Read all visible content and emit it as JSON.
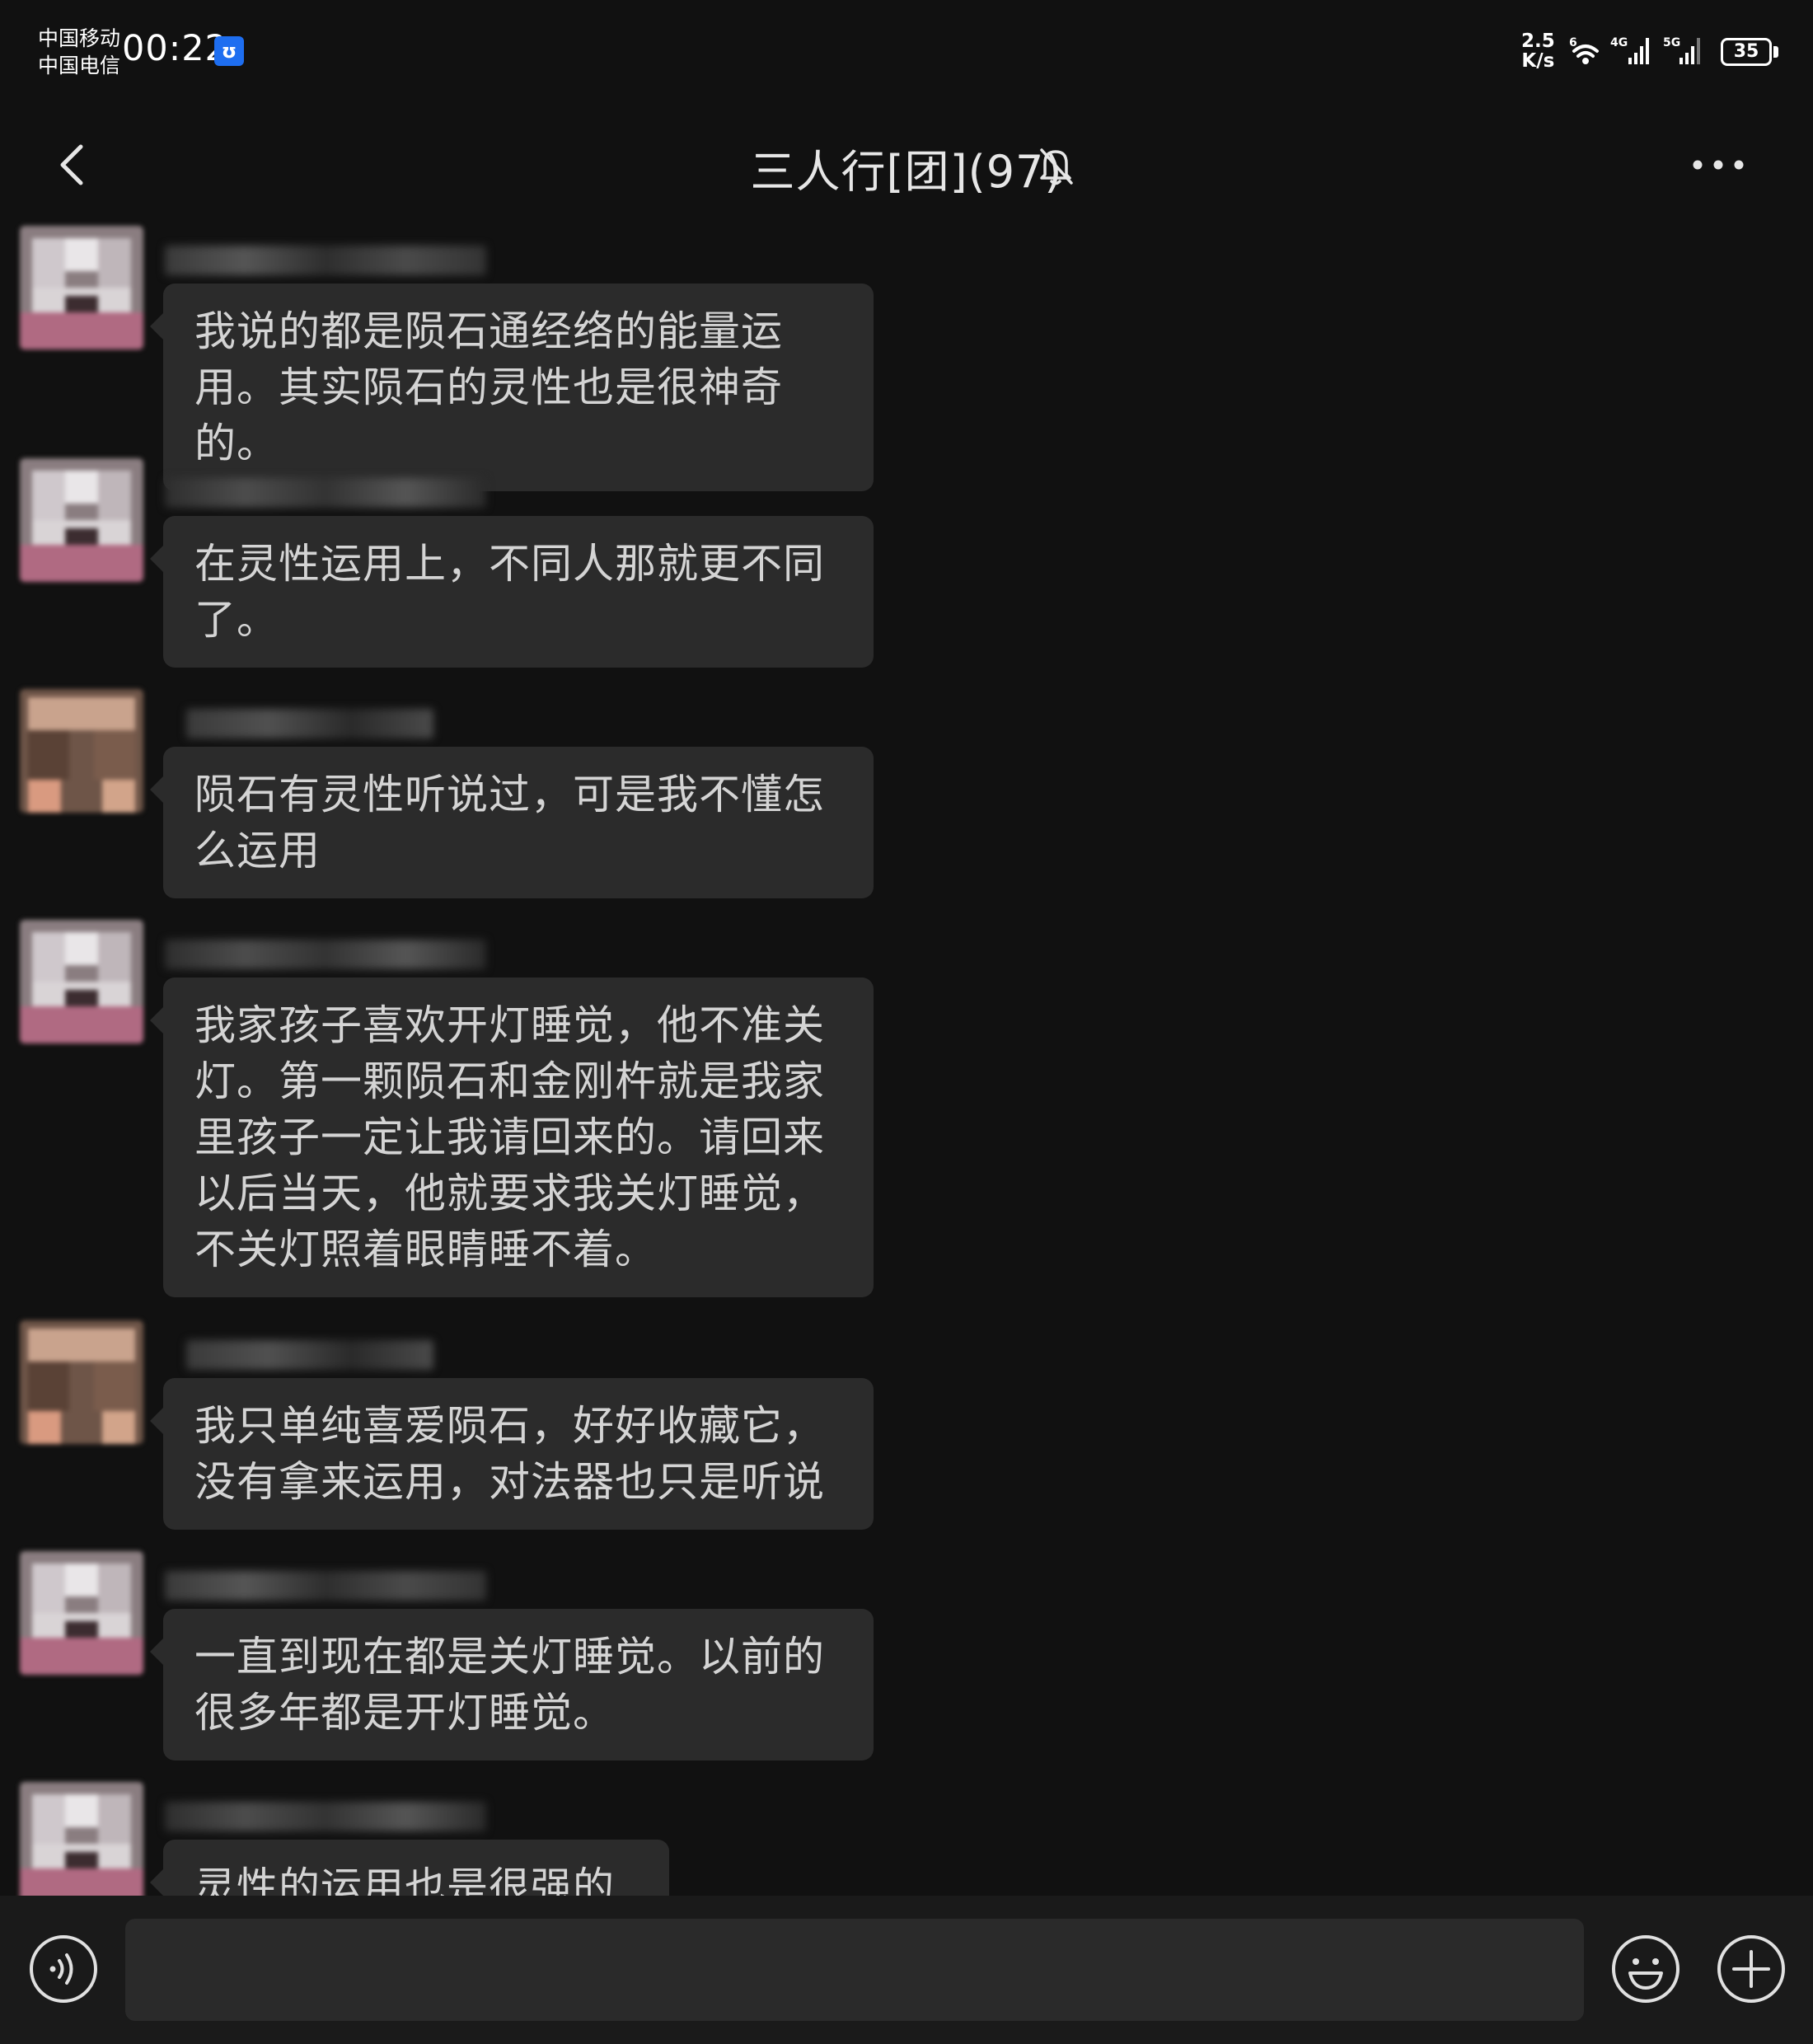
{
  "status_bar": {
    "carrier_1": "中国移动",
    "carrier_2": "中国电信",
    "time": "00:22",
    "app_badge": "ʊ",
    "speed_value": "2.5",
    "speed_unit": "K/s",
    "wifi_label": "6",
    "sim1_label": "4G",
    "sim2_label": "5G",
    "battery": "35"
  },
  "header": {
    "title": "三人行[团](97)",
    "back_icon": "chevron-left-icon",
    "mute_icon": "bell-off-icon",
    "more_icon": "more-dots-icon"
  },
  "messages": [
    {
      "text": "我说的都是陨石通经络的能量运用。其实陨石的灵性也是很神奇的。"
    },
    {
      "text": "在灵性运用上，不同人那就更不同了。"
    },
    {
      "text": "陨石有灵性听说过，可是我不懂怎么运用"
    },
    {
      "text": "我家孩子喜欢开灯睡觉，他不准关灯。第一颗陨石和金刚杵就是我家里孩子一定让我请回来的。请回来以后当天，他就要求我关灯睡觉，不关灯照着眼睛睡不着。"
    },
    {
      "text": "我只单纯喜爱陨石，好好收藏它，没有拿来运用，对法器也只是听说"
    },
    {
      "text": "一直到现在都是关灯睡觉。以前的很多年都是开灯睡觉。"
    },
    {
      "text": "灵性的运用也是很强的"
    }
  ],
  "input": {
    "value": "",
    "voice_icon": "voice-icon",
    "emoji_icon": "emoji-icon",
    "plus_icon": "plus-icon"
  }
}
